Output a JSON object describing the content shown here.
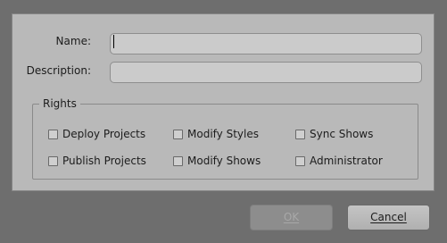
{
  "form": {
    "name_label": "Name:",
    "name_value": "",
    "description_label": "Description:",
    "description_value": ""
  },
  "rights": {
    "title": "Rights",
    "options": [
      {
        "label": "Deploy Projects",
        "checked": false
      },
      {
        "label": "Modify Styles",
        "checked": false
      },
      {
        "label": "Sync Shows",
        "checked": false
      },
      {
        "label": "Publish Projects",
        "checked": false
      },
      {
        "label": "Modify Shows",
        "checked": false
      },
      {
        "label": "Administrator",
        "checked": false
      }
    ]
  },
  "buttons": {
    "ok_label": "OK",
    "ok_enabled": false,
    "cancel_label": "Cancel"
  }
}
